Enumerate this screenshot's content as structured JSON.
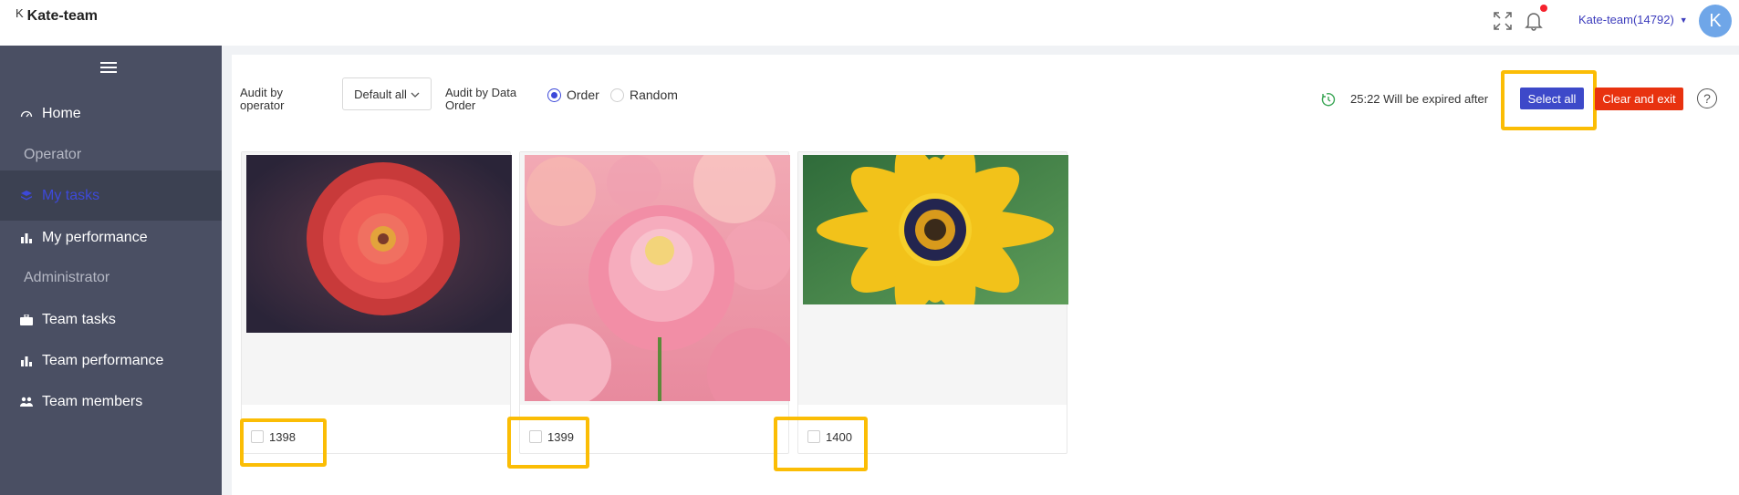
{
  "header": {
    "back_icon_text": "K",
    "title": "Kate-team",
    "user_label": "Kate-team(14792)",
    "avatar_initial": "K"
  },
  "sidebar": {
    "items": [
      {
        "label": "Home",
        "icon": "dashboard-icon",
        "type": "link"
      },
      {
        "label": "Operator",
        "type": "section"
      },
      {
        "label": "My tasks",
        "icon": "stack-icon",
        "type": "link",
        "active": true
      },
      {
        "label": "My performance",
        "icon": "bar-chart-icon",
        "type": "link"
      },
      {
        "label": "Administrator",
        "type": "section"
      },
      {
        "label": "Team tasks",
        "icon": "briefcase-icon",
        "type": "link"
      },
      {
        "label": "Team performance",
        "icon": "bar-chart-icon",
        "type": "link"
      },
      {
        "label": "Team members",
        "icon": "people-icon",
        "type": "link"
      }
    ]
  },
  "toolbar": {
    "audit_operator_label": "Audit by operator",
    "audit_operator_line1": "Audit by",
    "audit_operator_line2": "operator",
    "operator_select_value": "Default all",
    "audit_order_line1": "Audit by Data",
    "audit_order_line2": "Order",
    "radio_order": "Order",
    "radio_random": "Random",
    "selected_order": "Order",
    "timer_text": "25:22 Will be expired after",
    "select_all_label": "Select all",
    "clear_exit_label": "Clear and exit",
    "help_label": "?"
  },
  "cards": [
    {
      "id": "1398",
      "image": "red zinnia flower",
      "checked": false
    },
    {
      "id": "1399",
      "image": "pink dahlia flowers",
      "checked": false
    },
    {
      "id": "1400",
      "image": "yellow daisy flower",
      "checked": false
    }
  ],
  "colors": {
    "accent": "#3d49c9",
    "danger": "#e8320f",
    "highlight": "#fbbd05",
    "sidebar_bg": "#4a4f63"
  }
}
